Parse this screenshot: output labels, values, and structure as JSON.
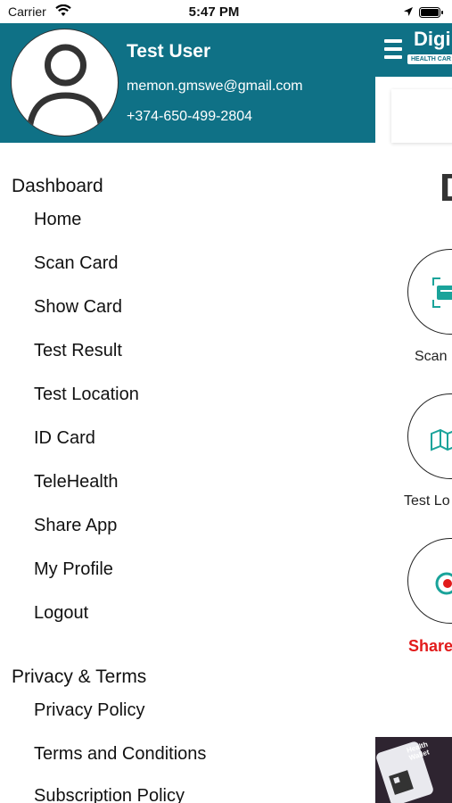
{
  "status_bar": {
    "carrier": "Carrier",
    "time": "5:47 PM",
    "wifi_icon": "wifi-icon",
    "location_icon": "location-arrow-icon",
    "battery_icon": "battery-icon"
  },
  "drawer": {
    "profile": {
      "avatar_icon": "user-avatar-icon",
      "name": "Test User",
      "email": "memon.gmswe@gmail.com",
      "phone": "+374-650-499-2804",
      "background_color": "#0f7186"
    },
    "sections": [
      {
        "title": "Dashboard",
        "items": [
          "Home",
          "Scan Card",
          "Show Card",
          "Test Result",
          "Test Location",
          "ID Card",
          "TeleHealth",
          "Share App",
          "My Profile",
          "Logout"
        ]
      },
      {
        "title": "Privacy & Terms",
        "items": [
          "Privacy Policy",
          "Terms and Conditions",
          "Subscription Policy"
        ]
      }
    ]
  },
  "app_background": {
    "menu_icon": "hamburger-menu-icon",
    "logo_text": "Digi",
    "logo_subtext": "HEALTH CAR",
    "heading_fragment": "D",
    "tiles": [
      {
        "label": "Scan",
        "icon": "scan-card-icon"
      },
      {
        "label": "Test Lo",
        "icon": "map-icon"
      },
      {
        "label": "Share",
        "icon": "share-icon"
      }
    ],
    "banner_text": "Health Wallet",
    "accent_color": "#0f7186",
    "share_color": "#e21b1b"
  }
}
